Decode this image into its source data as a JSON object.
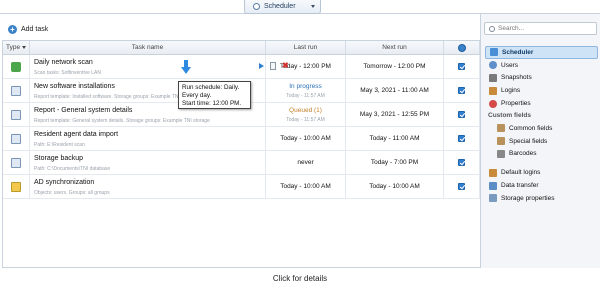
{
  "tab": {
    "label": "Scheduler"
  },
  "toolbar": {
    "add_label": "Add task"
  },
  "columns": {
    "type": "Type",
    "name": "Task name",
    "last": "Last run",
    "next": "Next run"
  },
  "rows": [
    {
      "name": "Daily network scan",
      "sub": "Scan tasks: Softinventive LAN",
      "last": "Today - 12:00 PM",
      "last_sub": "",
      "next": "Tomorrow - 12:00 PM",
      "icon": "network-scan-icon"
    },
    {
      "name": "New software installations",
      "sub": "Report template: Installed software. Storage groups: Example TNI storage",
      "last": "In progress",
      "last_sub": "Today - 11:57 AM",
      "next": "May 3, 2021 - 11:00 AM",
      "icon": "report-icon"
    },
    {
      "name": "Report - General system details",
      "sub": "Report template: General system details. Storage groups: Example TNI storage",
      "last": "Queued (1)",
      "last_sub": "Today - 11:57 AM",
      "next": "May 3, 2021 - 12:55 PM",
      "icon": "report-icon"
    },
    {
      "name": "Resident agent data import",
      "sub": "Path: E:\\Resident scan",
      "last": "Today - 10:00 AM",
      "last_sub": "",
      "next": "Today - 11:00 AM",
      "icon": "import-icon"
    },
    {
      "name": "Storage backup",
      "sub": "Path: C:\\Documents\\TNI database",
      "last": "never",
      "last_sub": "",
      "next": "Today - 7:00 PM",
      "icon": "backup-icon"
    },
    {
      "name": "AD synchronization",
      "sub": "Objects: users. Groups: all groups",
      "last": "Today - 10:00 AM",
      "last_sub": "",
      "next": "Today - 10:00 AM",
      "icon": "ad-sync-icon"
    }
  ],
  "tooltip": {
    "line1": "Run schedule: Daily.",
    "line2": "Every day.",
    "line3": "Start time: 12:00 PM."
  },
  "sidebar": {
    "search_placeholder": "Search...",
    "items": [
      {
        "label": "Scheduler"
      },
      {
        "label": "Users"
      },
      {
        "label": "Snapshots"
      },
      {
        "label": "Logins"
      },
      {
        "label": "Properties"
      }
    ],
    "custom_section": "Custom fields",
    "custom_items": [
      {
        "label": "Common fields"
      },
      {
        "label": "Special fields"
      },
      {
        "label": "Barcodes"
      }
    ],
    "bottom_items": [
      {
        "label": "Default logins"
      },
      {
        "label": "Data transfer"
      },
      {
        "label": "Storage properties"
      }
    ]
  },
  "caption": "Click for details",
  "colors": {
    "accent": "#2f7fd1",
    "in_progress": "#2c6fb5",
    "queued": "#c5812a"
  }
}
